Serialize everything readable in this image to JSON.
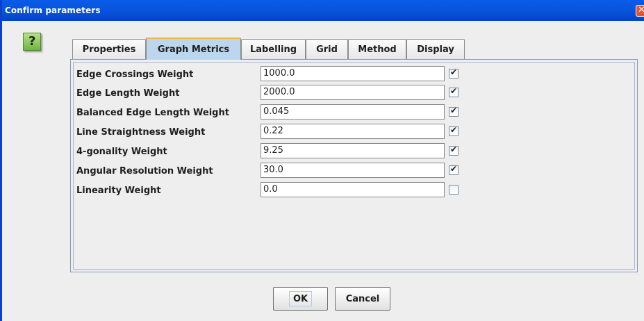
{
  "window": {
    "title": "Confirm parameters",
    "close_glyph": "✕"
  },
  "help": {
    "glyph": "?"
  },
  "tabs": [
    {
      "label": "Properties",
      "selected": false
    },
    {
      "label": "Graph Metrics",
      "selected": true
    },
    {
      "label": "Labelling",
      "selected": false
    },
    {
      "label": "Grid",
      "selected": false
    },
    {
      "label": "Method",
      "selected": false
    },
    {
      "label": "Display",
      "selected": false
    }
  ],
  "metrics": [
    {
      "label": "Edge Crossings Weight",
      "value": "1000.0",
      "checked": true
    },
    {
      "label": "Edge Length Weight",
      "value": "2000.0",
      "checked": true
    },
    {
      "label": "Balanced Edge Length Weight",
      "value": "0.045",
      "checked": true
    },
    {
      "label": "Line Straightness Weight",
      "value": "0.22",
      "checked": true
    },
    {
      "label": "4-gonality Weight",
      "value": "9.25",
      "checked": true
    },
    {
      "label": "Angular Resolution Weight",
      "value": "30.0",
      "checked": true
    },
    {
      "label": "Linearity Weight",
      "value": "0.0",
      "checked": false
    }
  ],
  "buttons": {
    "ok_label": "OK",
    "cancel_label": "Cancel"
  },
  "check_glyph": "✔"
}
